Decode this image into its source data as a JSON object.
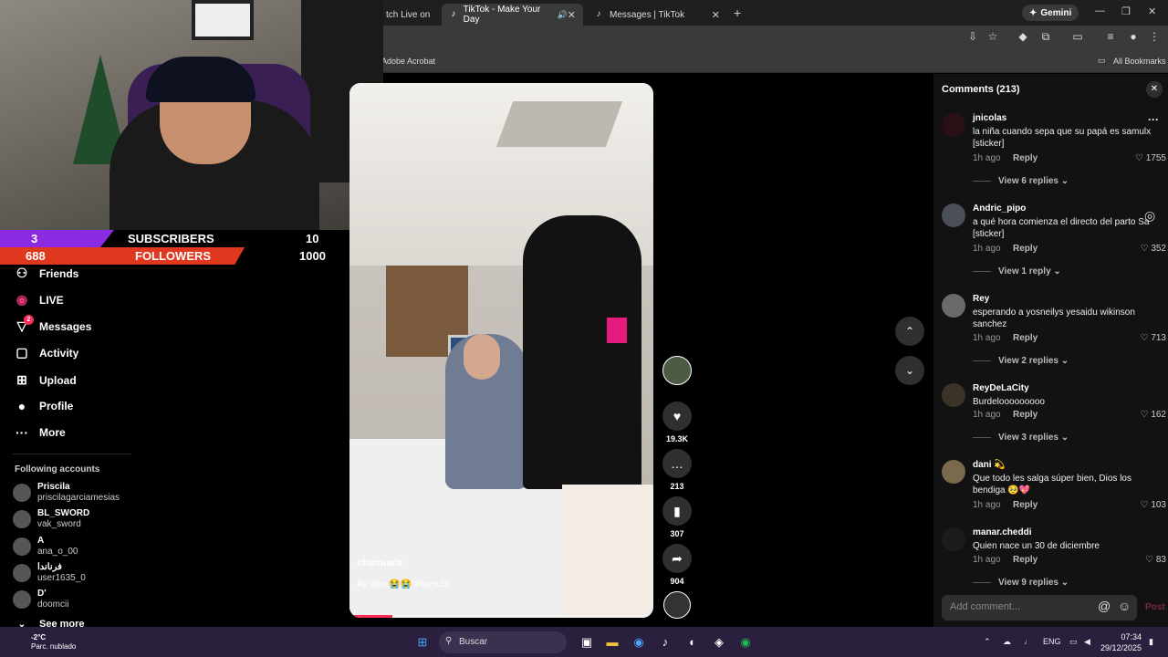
{
  "browser": {
    "tabs": [
      {
        "label": "tch Live on"
      },
      {
        "label": "TikTok - Make Your Day"
      },
      {
        "label": "Messages | TikTok"
      }
    ],
    "gemini_label": "Gemini",
    "bookmarks": {
      "adobe": "Adobe Acrobat",
      "all": "All Bookmarks"
    }
  },
  "stats": {
    "subscribers": {
      "current": "3",
      "label": "SUBSCRIBERS",
      "goal": "10"
    },
    "followers": {
      "current": "688",
      "label": "FOLLOWERS",
      "goal": "1000"
    }
  },
  "nav": {
    "items": [
      {
        "label": "Friends",
        "icon": "friends-icon"
      },
      {
        "label": "LIVE",
        "icon": "live-icon"
      },
      {
        "label": "Messages",
        "icon": "messages-icon",
        "badge": "2"
      },
      {
        "label": "Activity",
        "icon": "activity-icon"
      },
      {
        "label": "Upload",
        "icon": "upload-icon"
      },
      {
        "label": "Profile",
        "icon": "profile-icon"
      },
      {
        "label": "More",
        "icon": "more-icon"
      }
    ],
    "following_title": "Following accounts",
    "following": [
      {
        "name": "Priscila",
        "handle": "priscilagarciamesias"
      },
      {
        "name": "BL_SWORD",
        "handle": "vak_sword"
      },
      {
        "name": "A",
        "handle": "ana_o_00"
      },
      {
        "name": "فرناندا",
        "handle": "user1635_0"
      },
      {
        "name": "D'",
        "handle": "doomcii"
      }
    ],
    "see_more": "See more"
  },
  "video": {
    "username": "chamuelx",
    "caption": "Ay dios 😭😭 #samulx",
    "see_translation": "See translation",
    "progress": 0.14
  },
  "actions": {
    "likes": "19.3K",
    "comments": "213",
    "saves": "307",
    "shares": "904"
  },
  "comments": {
    "title": "Comments (213)",
    "add_placeholder": "Add comment...",
    "post": "Post",
    "reply_label": "Reply",
    "items": [
      {
        "user": "jnicolas",
        "text": "la niña cuando sepa que su papá es samulx [sticker]",
        "time": "1h ago",
        "likes": "1755",
        "view": "View 6 replies"
      },
      {
        "user": "Andric_pipo",
        "text": "a qué hora comienza el directo del parto Sa [sticker]",
        "time": "1h ago",
        "likes": "352",
        "view": "View 1 reply"
      },
      {
        "user": "Rey",
        "text": "esperando a yosneilys yesaidu wikinson sanchez",
        "time": "1h ago",
        "likes": "713",
        "view": "View 2 replies"
      },
      {
        "user": "ReyDeLaCity",
        "text": "Burdelooooooooo",
        "time": "1h ago",
        "likes": "162",
        "view": "View 3 replies"
      },
      {
        "user": "dani 💫",
        "text": "Que todo les salga súper bien, Dios los bendiga 🥺💖",
        "time": "1h ago",
        "likes": "103",
        "view": ""
      },
      {
        "user": "manar.cheddi",
        "text": "Quien nace un 30 de diciembre",
        "time": "1h ago",
        "likes": "83",
        "view": "View 9 replies"
      }
    ]
  },
  "taskbar": {
    "weather_temp": "-2°C",
    "weather_desc": "Parc. nublado",
    "search": "Buscar",
    "lang": "ENG",
    "time": "07:34",
    "date": "29/12/2025"
  }
}
